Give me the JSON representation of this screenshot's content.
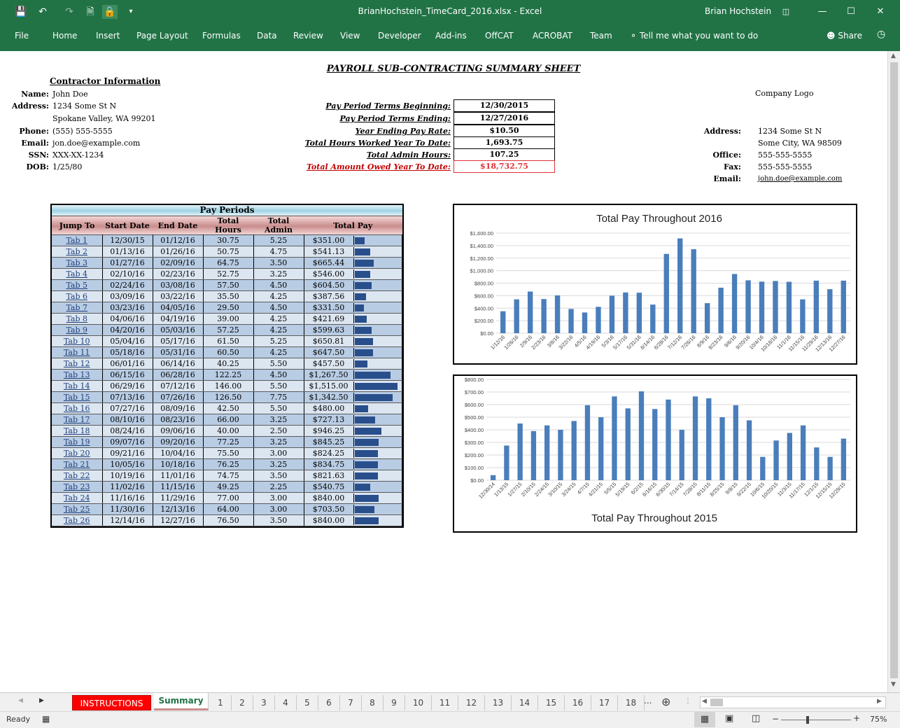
{
  "window": {
    "file_title": "BrianHochstein_TimeCard_2016.xlsx  -  Excel",
    "user": "Brian Hochstein"
  },
  "ribbon": {
    "tabs": [
      "File",
      "Home",
      "Insert",
      "Page Layout",
      "Formulas",
      "Data",
      "Review",
      "View",
      "Developer",
      "Add-ins",
      "OffCAT",
      "ACROBAT",
      "Team"
    ],
    "tell_me": "Tell me what you want to do",
    "share": "Share"
  },
  "sheet": {
    "title": "PAYROLL SUB-CONTRACTING SUMMARY SHEET",
    "contractor_header": "Contractor Information",
    "contractor": {
      "name_label": "Name:",
      "name": "John Doe",
      "address_label": "Address:",
      "address1": "1234 Some St N",
      "address2": "Spokane Valley, WA 99201",
      "phone_label": "Phone:",
      "phone": "(555) 555-5555",
      "email_label": "Email:",
      "email": "jon.doe@example.com",
      "ssn_label": "SSN:",
      "ssn": "XXX-XX-1234",
      "dob_label": "DOB:",
      "dob": "1/25/80"
    },
    "info": [
      {
        "label": "Pay Period Terms Beginning:",
        "value": "12/30/2015"
      },
      {
        "label": "Pay Period Terms Ending:",
        "value": "12/27/2016"
      },
      {
        "label": "Year Ending Pay Rate:",
        "value": "$10.50"
      },
      {
        "label": "Total Hours Worked Year To Date:",
        "value": "1,693.75"
      },
      {
        "label": "Total Admin Hours:",
        "value": "107.25"
      },
      {
        "label": "Total Amount Owed Year To Date:",
        "value": "$18,732.75"
      }
    ],
    "company": {
      "logo": "Company Logo",
      "address_label": "Address:",
      "address1": "1234 Some St N",
      "address2": "Some City, WA 98509",
      "office_label": "Office:",
      "office": "555-555-5555",
      "fax_label": "Fax:",
      "fax": "555-555-5555",
      "email_label": "Email:",
      "email": "john.doe@example.com"
    },
    "pay_periods": {
      "title": "Pay Periods",
      "headers": [
        "Jump To",
        "Start Date",
        "End Date",
        "Total Hours",
        "Total Admin",
        "Total Pay"
      ],
      "rows": [
        [
          "Tab 1",
          "12/30/15",
          "01/12/16",
          "30.75",
          "5.25",
          "$351.00"
        ],
        [
          "Tab 2",
          "01/13/16",
          "01/26/16",
          "50.75",
          "4.75",
          "$541.13"
        ],
        [
          "Tab 3",
          "01/27/16",
          "02/09/16",
          "64.75",
          "3.50",
          "$665.44"
        ],
        [
          "Tab 4",
          "02/10/16",
          "02/23/16",
          "52.75",
          "3.25",
          "$546.00"
        ],
        [
          "Tab 5",
          "02/24/16",
          "03/08/16",
          "57.50",
          "4.50",
          "$604.50"
        ],
        [
          "Tab 6",
          "03/09/16",
          "03/22/16",
          "35.50",
          "4.25",
          "$387.56"
        ],
        [
          "Tab 7",
          "03/23/16",
          "04/05/16",
          "29.50",
          "4.50",
          "$331.50"
        ],
        [
          "Tab 8",
          "04/06/16",
          "04/19/16",
          "39.00",
          "4.25",
          "$421.69"
        ],
        [
          "Tab 9",
          "04/20/16",
          "05/03/16",
          "57.25",
          "4.25",
          "$599.63"
        ],
        [
          "Tab 10",
          "05/04/16",
          "05/17/16",
          "61.50",
          "5.25",
          "$650.81"
        ],
        [
          "Tab 11",
          "05/18/16",
          "05/31/16",
          "60.50",
          "4.25",
          "$647.50"
        ],
        [
          "Tab 12",
          "06/01/16",
          "06/14/16",
          "40.25",
          "5.50",
          "$457.50"
        ],
        [
          "Tab 13",
          "06/15/16",
          "06/28/16",
          "122.25",
          "4.50",
          "$1,267.50"
        ],
        [
          "Tab 14",
          "06/29/16",
          "07/12/16",
          "146.00",
          "5.50",
          "$1,515.00"
        ],
        [
          "Tab 15",
          "07/13/16",
          "07/26/16",
          "126.50",
          "7.75",
          "$1,342.50"
        ],
        [
          "Tab 16",
          "07/27/16",
          "08/09/16",
          "42.50",
          "5.50",
          "$480.00"
        ],
        [
          "Tab 17",
          "08/10/16",
          "08/23/16",
          "66.00",
          "3.25",
          "$727.13"
        ],
        [
          "Tab 18",
          "08/24/16",
          "09/06/16",
          "40.00",
          "2.50",
          "$946.25"
        ],
        [
          "Tab 19",
          "09/07/16",
          "09/20/16",
          "77.25",
          "3.25",
          "$845.25"
        ],
        [
          "Tab 20",
          "09/21/16",
          "10/04/16",
          "75.50",
          "3.00",
          "$824.25"
        ],
        [
          "Tab 21",
          "10/05/16",
          "10/18/16",
          "76.25",
          "3.25",
          "$834.75"
        ],
        [
          "Tab 22",
          "10/19/16",
          "11/01/16",
          "74.75",
          "3.50",
          "$821.63"
        ],
        [
          "Tab 23",
          "11/02/16",
          "11/15/16",
          "49.25",
          "2.25",
          "$540.75"
        ],
        [
          "Tab 24",
          "11/16/16",
          "11/29/16",
          "77.00",
          "3.00",
          "$840.00"
        ],
        [
          "Tab 25",
          "11/30/16",
          "12/13/16",
          "64.00",
          "3.00",
          "$703.50"
        ],
        [
          "Tab 26",
          "12/14/16",
          "12/27/16",
          "76.50",
          "3.50",
          "$840.00"
        ]
      ],
      "pay_values": [
        351.0,
        541.13,
        665.44,
        546.0,
        604.5,
        387.56,
        331.5,
        421.69,
        599.63,
        650.81,
        647.5,
        457.5,
        1267.5,
        1515.0,
        1342.5,
        480.0,
        727.13,
        946.25,
        845.25,
        824.25,
        834.75,
        821.63,
        540.75,
        840.0,
        703.5,
        840.0
      ]
    }
  },
  "chart_data": [
    {
      "type": "bar",
      "title": "Total Pay Throughout 2016",
      "categories": [
        "1/12/16",
        "1/26/16",
        "2/9/16",
        "2/23/16",
        "3/8/16",
        "3/22/16",
        "4/5/16",
        "4/19/16",
        "5/3/16",
        "5/17/16",
        "5/31/16",
        "6/14/16",
        "6/28/16",
        "7/12/16",
        "7/26/16",
        "8/9/16",
        "8/23/16",
        "9/6/16",
        "9/20/16",
        "10/4/16",
        "10/18/16",
        "11/1/16",
        "11/15/16",
        "11/29/16",
        "12/13/16",
        "12/27/16"
      ],
      "values": [
        351.0,
        541.13,
        665.44,
        546.0,
        604.5,
        387.56,
        331.5,
        421.69,
        599.63,
        650.81,
        647.5,
        457.5,
        1267.5,
        1515.0,
        1342.5,
        480.0,
        727.13,
        946.25,
        845.25,
        824.25,
        834.75,
        821.63,
        540.75,
        840.0,
        703.5,
        840.0
      ],
      "ylim": [
        0,
        1600
      ],
      "yticks": [
        "$0.00",
        "$200.00",
        "$400.00",
        "$600.00",
        "$800.00",
        "$1,000.00",
        "$1,200.00",
        "$1,400.00",
        "$1,600.00"
      ],
      "color": "#4a7ebb"
    },
    {
      "type": "bar",
      "title": "Total Pay Throughout 2015",
      "categories": [
        "12/30/14",
        "1/13/15",
        "1/27/15",
        "2/10/15",
        "2/24/15",
        "3/10/15",
        "3/24/15",
        "4/7/15",
        "4/21/15",
        "5/5/15",
        "5/19/15",
        "6/2/15",
        "6/16/15",
        "6/30/15",
        "7/14/15",
        "7/28/15",
        "8/11/15",
        "8/25/15",
        "9/8/15",
        "9/22/15",
        "10/6/15",
        "10/20/15",
        "11/3/15",
        "11/17/15",
        "12/1/15",
        "12/15/15",
        "12/29/15"
      ],
      "values": [
        40,
        275,
        450,
        390,
        435,
        400,
        470,
        595,
        500,
        665,
        570,
        705,
        565,
        640,
        400,
        665,
        650,
        500,
        595,
        475,
        185,
        315,
        375,
        435,
        260,
        185,
        330
      ],
      "ylim": [
        0,
        800
      ],
      "yticks": [
        "$0.00",
        "$100.00",
        "$200.00",
        "$300.00",
        "$400.00",
        "$500.00",
        "$600.00",
        "$700.00",
        "$800.00"
      ],
      "color": "#4a7ebb"
    }
  ],
  "sheet_tabs": {
    "instructions": "INSTRUCTIONS",
    "summary": "Summary",
    "numbered": [
      "1",
      "2",
      "3",
      "4",
      "5",
      "6",
      "7",
      "8",
      "9",
      "10",
      "11",
      "12",
      "13",
      "14",
      "15",
      "16",
      "17",
      "18"
    ],
    "more": "..."
  },
  "status": {
    "ready": "Ready",
    "zoom": "75%"
  }
}
